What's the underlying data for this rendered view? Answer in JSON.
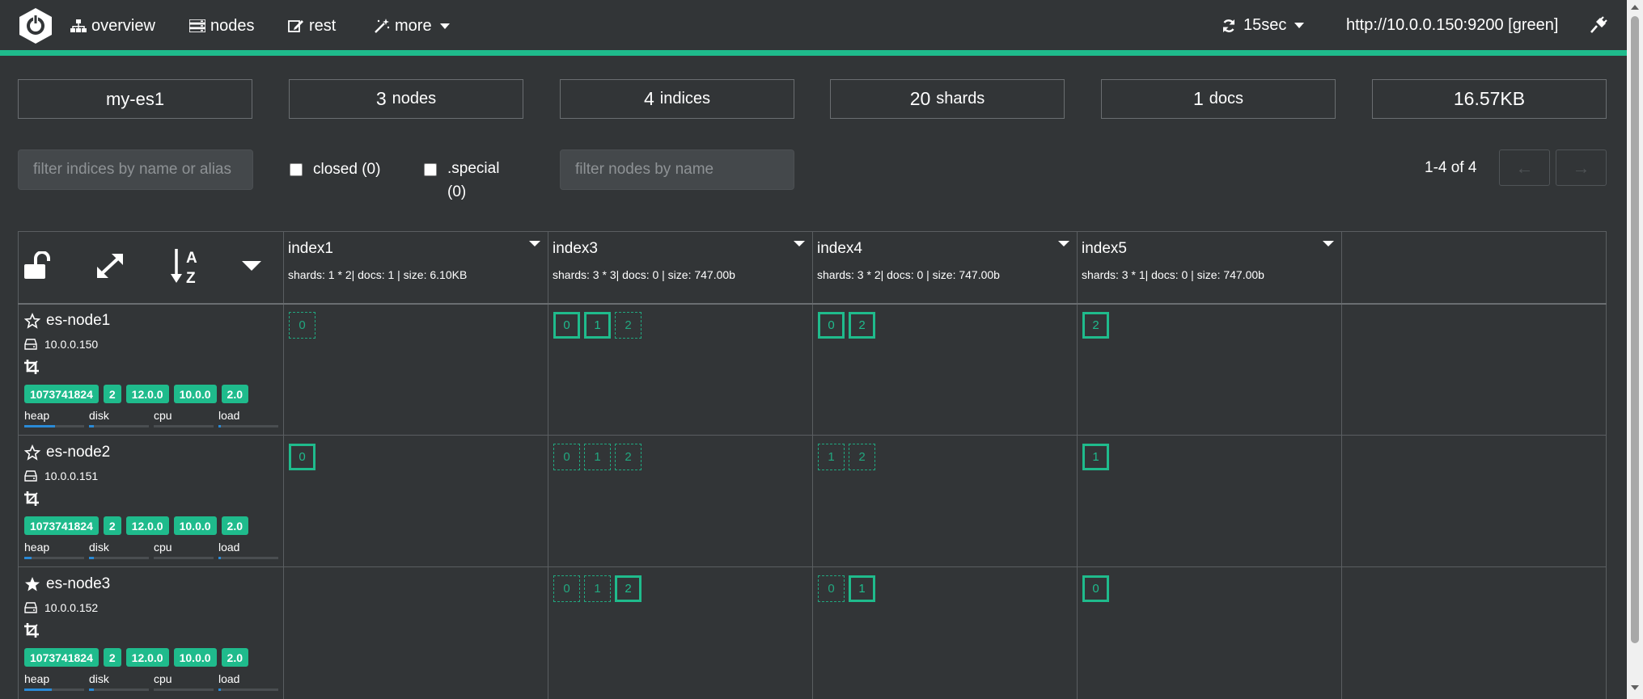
{
  "navbar": {
    "items": [
      {
        "label": "overview",
        "icon": "sitemap-icon"
      },
      {
        "label": "nodes",
        "icon": "server-icon"
      },
      {
        "label": "rest",
        "icon": "edit-icon"
      },
      {
        "label": "more",
        "icon": "magic-wand-icon"
      }
    ],
    "refresh_label": "15sec",
    "cluster_url": "http://10.0.0.150:9200 [green]",
    "accent_color": "#1fbb8c"
  },
  "stats": {
    "cluster_name": "my-es1",
    "nodes_count": "3",
    "nodes_label": "nodes",
    "indices_count": "4",
    "indices_label": "indices",
    "shards_count": "20",
    "shards_label": "shards",
    "docs_count": "1",
    "docs_label": "docs",
    "size": "16.57KB"
  },
  "filters": {
    "indices_placeholder": "filter indices by name or alias",
    "closed_label": "closed (0)",
    "special_label": ".special",
    "special_count": "(0)",
    "nodes_placeholder": "filter nodes by name",
    "pagination": "1-4 of 4",
    "prev_symbol": "←",
    "next_symbol": "→"
  },
  "indices": [
    {
      "name": "index1",
      "meta": "shards: 1 * 2| docs: 1 | size: 6.10KB"
    },
    {
      "name": "index3",
      "meta": "shards: 3 * 3| docs: 0 | size: 747.00b"
    },
    {
      "name": "index4",
      "meta": "shards: 3 * 2| docs: 0 | size: 747.00b"
    },
    {
      "name": "index5",
      "meta": "shards: 3 * 1| docs: 0 | size: 747.00b"
    }
  ],
  "nodes": [
    {
      "name": "es-node1",
      "ip": "10.0.0.150",
      "master": false,
      "badges": [
        "1073741824",
        "2",
        "12.0.0",
        "10.0.0",
        "2.0"
      ],
      "metrics": {
        "heap": 0.52,
        "disk": 0.08,
        "cpu": 0.0,
        "load": 0.04
      }
    },
    {
      "name": "es-node2",
      "ip": "10.0.0.151",
      "master": false,
      "badges": [
        "1073741824",
        "2",
        "12.0.0",
        "10.0.0",
        "2.0"
      ],
      "metrics": {
        "heap": 0.12,
        "disk": 0.08,
        "cpu": 0.0,
        "load": 0.04
      }
    },
    {
      "name": "es-node3",
      "ip": "10.0.0.152",
      "master": true,
      "badges": [
        "1073741824",
        "2",
        "12.0.0",
        "10.0.0",
        "2.0"
      ],
      "metrics": {
        "heap": 0.46,
        "disk": 0.08,
        "cpu": 0.0,
        "load": 0.04
      }
    }
  ],
  "metric_labels": [
    "heap",
    "disk",
    "cpu",
    "load"
  ],
  "shards": [
    [
      [
        {
          "n": "0",
          "p": false
        }
      ],
      [
        {
          "n": "0",
          "p": true
        },
        {
          "n": "1",
          "p": true
        },
        {
          "n": "2",
          "p": false
        }
      ],
      [
        {
          "n": "0",
          "p": true
        },
        {
          "n": "2",
          "p": true
        }
      ],
      [
        {
          "n": "2",
          "p": true
        }
      ]
    ],
    [
      [
        {
          "n": "0",
          "p": true
        }
      ],
      [
        {
          "n": "0",
          "p": false
        },
        {
          "n": "1",
          "p": false
        },
        {
          "n": "2",
          "p": false
        }
      ],
      [
        {
          "n": "1",
          "p": false
        },
        {
          "n": "2",
          "p": false
        }
      ],
      [
        {
          "n": "1",
          "p": true
        }
      ]
    ],
    [
      [],
      [
        {
          "n": "0",
          "p": false
        },
        {
          "n": "1",
          "p": false
        },
        {
          "n": "2",
          "p": true
        }
      ],
      [
        {
          "n": "0",
          "p": false
        },
        {
          "n": "1",
          "p": true
        }
      ],
      [
        {
          "n": "0",
          "p": true
        }
      ]
    ]
  ]
}
